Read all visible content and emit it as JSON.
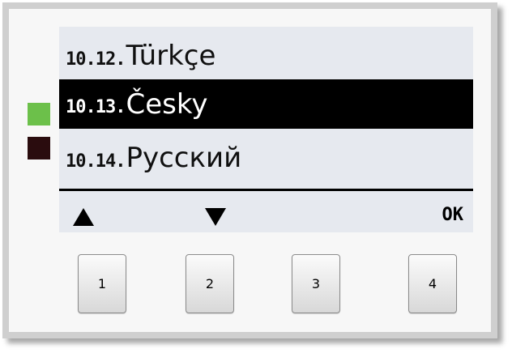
{
  "leds": {
    "green_color": "#6cc04a",
    "red_color": "#2a0c0e"
  },
  "menu": {
    "items": [
      {
        "number": "10.12.",
        "label": "Türkçe",
        "selected": false
      },
      {
        "number": "10.13.",
        "label": "Česky",
        "selected": true
      },
      {
        "number": "10.14.",
        "label": "Русский",
        "selected": false
      }
    ]
  },
  "softkeys": {
    "up": "up-arrow",
    "down": "down-arrow",
    "ok_label": "OK"
  },
  "buttons": {
    "b1": "1",
    "b2": "2",
    "b3": "3",
    "b4": "4"
  }
}
